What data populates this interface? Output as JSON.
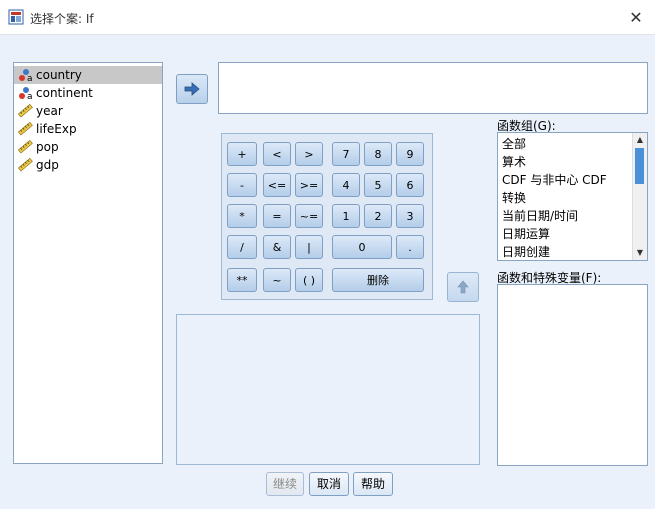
{
  "window": {
    "title": "选择个案: If",
    "close_glyph": "✕"
  },
  "variables": [
    {
      "name": "country",
      "type": "string",
      "selected": true
    },
    {
      "name": "continent",
      "type": "string",
      "selected": false
    },
    {
      "name": "year",
      "type": "scale",
      "selected": false
    },
    {
      "name": "lifeExp",
      "type": "scale",
      "selected": false
    },
    {
      "name": "pop",
      "type": "scale",
      "selected": false
    },
    {
      "name": "gdp",
      "type": "scale",
      "selected": false
    }
  ],
  "keypad": {
    "plus": "+",
    "lt": "<",
    "gt": ">",
    "seven": "7",
    "eight": "8",
    "nine": "9",
    "minus": "-",
    "le": "<=",
    "ge": ">=",
    "four": "4",
    "five": "5",
    "six": "6",
    "mult": "*",
    "eq": "=",
    "ne": "~=",
    "one": "1",
    "two": "2",
    "three": "3",
    "div": "/",
    "and": "&",
    "or": "|",
    "zero": "0",
    "dot": ".",
    "pow": "**",
    "not": "~",
    "paren": "( )",
    "delete": "删除"
  },
  "function_group": {
    "label": "函数组(G):",
    "items": [
      "全部",
      "算术",
      "CDF 与非中心 CDF",
      "转换",
      "当前日期/时间",
      "日期运算",
      "日期创建"
    ]
  },
  "functions": {
    "label": "函数和特殊变量(F):"
  },
  "footer": {
    "continue": "继续",
    "cancel": "取消",
    "help": "帮助"
  }
}
